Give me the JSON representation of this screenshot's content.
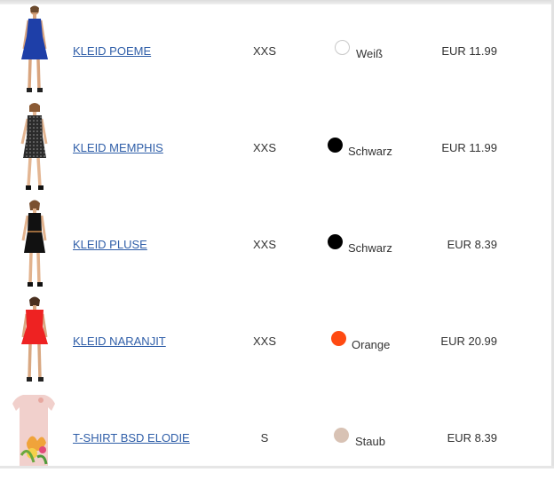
{
  "items": [
    {
      "name": "KLEID POEME",
      "size": "XXS",
      "color_name": "Weiß",
      "color_hex": "#ffffff",
      "price": "EUR 11.99",
      "dress_color": "#1e3fa8",
      "icon": "blue-dress-icon"
    },
    {
      "name": "KLEID MEMPHIS",
      "size": "XXS",
      "color_name": "Schwarz",
      "color_hex": "#000000",
      "price": "EUR 11.99",
      "dress_color": "#2b2b2b",
      "icon": "black-dotted-dress-icon"
    },
    {
      "name": "KLEID PLUSE",
      "size": "XXS",
      "color_name": "Schwarz",
      "color_hex": "#000000",
      "price": "EUR 8.39",
      "dress_color": "#111111",
      "icon": "black-dress-icon"
    },
    {
      "name": "KLEID NARANJIT",
      "size": "XXS",
      "color_name": "Orange",
      "color_hex": "#ff4a12",
      "price": "EUR 20.99",
      "dress_color": "#ee2222",
      "icon": "red-dress-icon"
    },
    {
      "name": "T-SHIRT BSD ELODIE",
      "size": "S",
      "color_name": "Staub",
      "color_hex": "#d8c2b4",
      "price": "EUR 8.39",
      "dress_color": "#f1d0cc",
      "icon": "floral-tshirt-icon"
    }
  ]
}
